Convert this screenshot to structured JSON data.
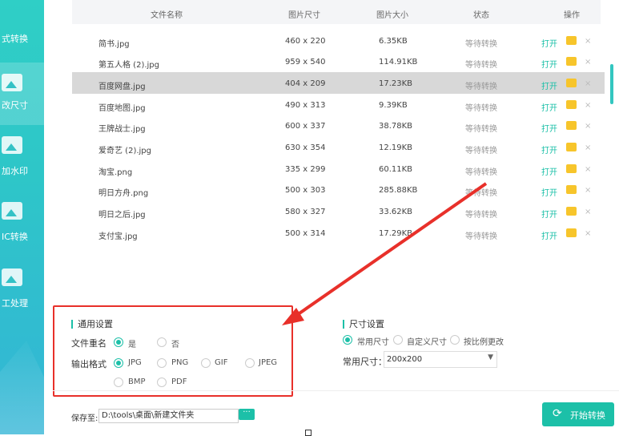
{
  "sidebar": {
    "items": [
      {
        "label": "式转换"
      },
      {
        "label": "改尺寸"
      },
      {
        "label": "加水印"
      },
      {
        "label": "IC转换"
      },
      {
        "label": "工处理"
      }
    ]
  },
  "table": {
    "headers": [
      "文件名称",
      "图片尺寸",
      "图片大小",
      "状态",
      "操作"
    ],
    "rows": [
      {
        "name": "简书.jpg",
        "dim": "460 x 220",
        "size": "6.35KB",
        "status": "等待转换",
        "open": "打开",
        "del": "×"
      },
      {
        "name": "第五人格 (2).jpg",
        "dim": "959 x 540",
        "size": "114.91KB",
        "status": "等待转换",
        "open": "打开",
        "del": "×"
      },
      {
        "name": "百度网盘.jpg",
        "dim": "404 x 209",
        "size": "17.23KB",
        "status": "等待转换",
        "open": "打开",
        "del": "×"
      },
      {
        "name": "百度地图.jpg",
        "dim": "490 x 313",
        "size": "9.39KB",
        "status": "等待转换",
        "open": "打开",
        "del": "×"
      },
      {
        "name": "王牌战士.jpg",
        "dim": "600 x 337",
        "size": "38.78KB",
        "status": "等待转换",
        "open": "打开",
        "del": "×"
      },
      {
        "name": "爱奇艺 (2).jpg",
        "dim": "630 x 354",
        "size": "12.19KB",
        "status": "等待转换",
        "open": "打开",
        "del": "×"
      },
      {
        "name": "淘宝.png",
        "dim": "335 x 299",
        "size": "60.11KB",
        "status": "等待转换",
        "open": "打开",
        "del": "×"
      },
      {
        "name": "明日方舟.png",
        "dim": "500 x 303",
        "size": "285.88KB",
        "status": "等待转换",
        "open": "打开",
        "del": "×"
      },
      {
        "name": "明日之后.jpg",
        "dim": "580 x 327",
        "size": "33.62KB",
        "status": "等待转换",
        "open": "打开",
        "del": "×"
      },
      {
        "name": "支付宝.jpg",
        "dim": "500 x 314",
        "size": "17.29KB",
        "status": "等待转换",
        "open": "打开",
        "del": "×"
      }
    ]
  },
  "general": {
    "title": "通用设置",
    "rename_label": "文件重名",
    "rename_yes": "是",
    "rename_no": "否",
    "format_label": "输出格式",
    "formats": [
      "JPG",
      "PNG",
      "GIF",
      "JPEG",
      "BMP",
      "PDF"
    ],
    "selected_format": "JPG"
  },
  "size_settings": {
    "title": "尺寸设置",
    "options": [
      "常用尺寸",
      "自定义尺寸",
      "按比例更改"
    ],
    "common_label": "常用尺寸：",
    "common_value": "200x200"
  },
  "footer": {
    "save_label": "保存至:",
    "path": "D:\\tools\\桌面\\新建文件夹",
    "browse": "···",
    "start": "开始转换"
  },
  "colors": {
    "accent": "#1cc0a8",
    "highlight": "#e8302a"
  }
}
